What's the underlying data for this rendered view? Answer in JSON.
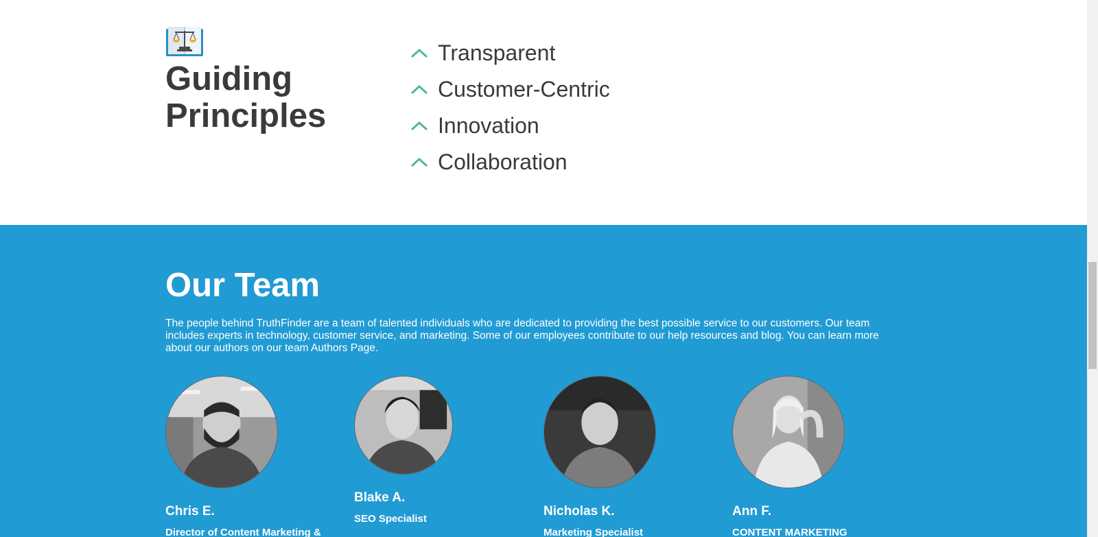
{
  "principles": {
    "icon": "scale-book-icon",
    "title": "Guiding Principles",
    "items": [
      {
        "label": "Transparent",
        "icon": "chevron-up-icon"
      },
      {
        "label": "Customer-Centric",
        "icon": "chevron-up-icon"
      },
      {
        "label": "Innovation",
        "icon": "chevron-up-icon"
      },
      {
        "label": "Collaboration",
        "icon": "chevron-up-icon"
      }
    ],
    "accent_color": "#4fb98f"
  },
  "team": {
    "title": "Our Team",
    "description": "The people behind TruthFinder are a team of talented individuals who are dedicated to providing the best possible service to our customers. Our team includes experts in technology, customer service, and marketing. Some of our employees contribute to our help resources and blog. You can learn more about our authors on our team Authors Page.",
    "background_color": "#219bd3",
    "members": [
      {
        "name": "Chris E.",
        "role": "Director of Content Marketing &"
      },
      {
        "name": "Blake A.",
        "role": "SEO Specialist"
      },
      {
        "name": "Nicholas K.",
        "role": "Marketing Specialist"
      },
      {
        "name": "Ann F.",
        "role": "CONTENT MARKETING"
      }
    ]
  }
}
